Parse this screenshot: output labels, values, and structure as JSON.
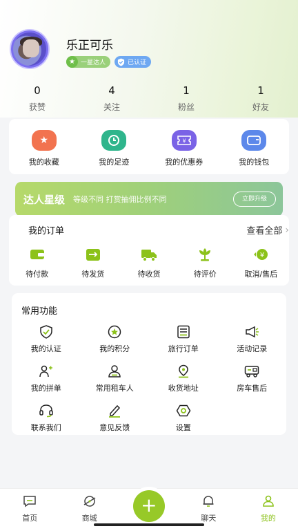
{
  "profile": {
    "name": "乐正可乐",
    "level_badge": "一星达人",
    "verify_badge": "已认证"
  },
  "stats": [
    {
      "value": "0",
      "label": "获赞"
    },
    {
      "value": "4",
      "label": "关注"
    },
    {
      "value": "1",
      "label": "粉丝"
    },
    {
      "value": "1",
      "label": "好友"
    }
  ],
  "quick": [
    {
      "label": "我的收藏",
      "icon": "star-icon",
      "color": "#f2734f"
    },
    {
      "label": "我的足迹",
      "icon": "clock-icon",
      "color": "#2fb58c"
    },
    {
      "label": "我的优惠券",
      "icon": "coupon-icon",
      "color": "#7a63e6"
    },
    {
      "label": "我的钱包",
      "icon": "wallet-icon",
      "color": "#5c88ea"
    }
  ],
  "banner": {
    "title": "达人星级",
    "desc": "等级不同  打赏抽佣比例不同",
    "button": "立即升级"
  },
  "orders": {
    "title": "我的订单",
    "more": "查看全部",
    "items": [
      {
        "label": "待付款",
        "icon": "wallet-icon"
      },
      {
        "label": "待发货",
        "icon": "box-icon"
      },
      {
        "label": "待收货",
        "icon": "truck-icon"
      },
      {
        "label": "待评价",
        "icon": "flower-icon"
      },
      {
        "label": "取消/售后",
        "icon": "refund-icon"
      }
    ]
  },
  "functions": {
    "title": "常用功能",
    "items": [
      {
        "label": "我的认证",
        "icon": "shield-check-icon"
      },
      {
        "label": "我的积分",
        "icon": "points-icon"
      },
      {
        "label": "旅行订单",
        "icon": "list-icon"
      },
      {
        "label": "活动记录",
        "icon": "megaphone-icon"
      },
      {
        "label": "我的拼单",
        "icon": "group-icon"
      },
      {
        "label": "常用租车人",
        "icon": "person-icon"
      },
      {
        "label": "收货地址",
        "icon": "location-icon"
      },
      {
        "label": "房车售后",
        "icon": "rv-icon"
      },
      {
        "label": "联系我们",
        "icon": "headset-icon"
      },
      {
        "label": "意见反馈",
        "icon": "edit-icon"
      },
      {
        "label": "设置",
        "icon": "settings-icon"
      }
    ]
  },
  "tabbar": {
    "items": [
      {
        "label": "首页"
      },
      {
        "label": "商城"
      },
      {
        "label": "聊天"
      },
      {
        "label": "我的"
      }
    ],
    "plus": "+"
  },
  "colors": {
    "accent": "#8cc21a",
    "icon_green": "#8cc21a"
  }
}
